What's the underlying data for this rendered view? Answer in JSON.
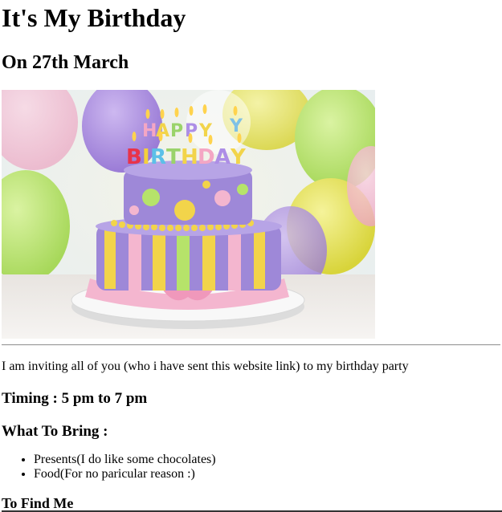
{
  "header": {
    "title": "It's My Birthday",
    "date": "On 27th March"
  },
  "hero_image": {
    "banner_text": "HAPPY BIRTHDAY",
    "colors": {
      "balloon_purple": "#a98bdc",
      "balloon_yellow": "#e6e34a",
      "balloon_green": "#b6e36a",
      "cake_purple": "#9c86d8",
      "cake_pink": "#f2a8c8",
      "cake_yellow": "#f2d44a",
      "plate": "#f4f4f4"
    }
  },
  "invite": {
    "text": "I am inviting all of you (who i have sent this website link) to my birthday party"
  },
  "timing": {
    "label": "Timing : 5 pm to 7 pm"
  },
  "bring": {
    "heading": "What To Bring :",
    "items": [
      "Presents(I do like some chocolates)",
      "Food(For no paricular reason :)"
    ]
  },
  "find": {
    "heading": "To Find Me"
  }
}
